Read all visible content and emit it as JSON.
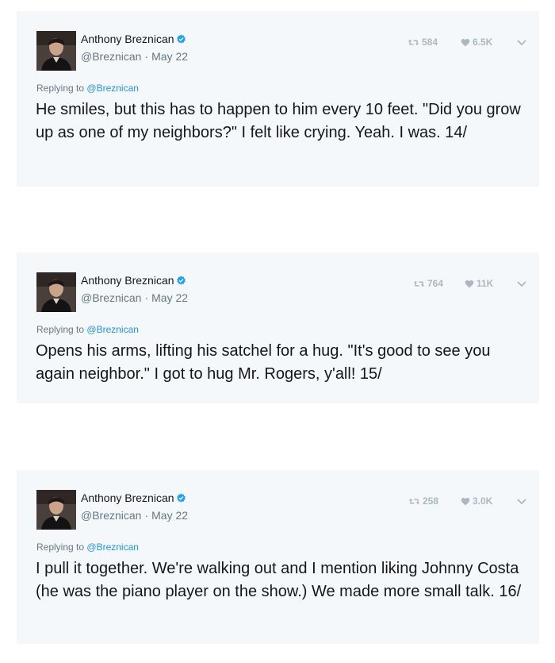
{
  "tweets": [
    {
      "author_name": "Anthony Breznican",
      "handle": "@Breznican",
      "date": "May 22",
      "retweets": "584",
      "likes": "6.5K",
      "replying_prefix": "Replying to",
      "replying_handle": "@Breznican",
      "text": "He smiles, but this has to happen to him every 10 feet. \"Did you grow up as one of my neighbors?\" I felt like crying. Yeah. I was. 14/"
    },
    {
      "author_name": "Anthony Breznican",
      "handle": "@Breznican",
      "date": "May 22",
      "retweets": "764",
      "likes": "11K",
      "replying_prefix": "Replying to",
      "replying_handle": "@Breznican",
      "text": "Opens his arms, lifting his satchel for a hug. \"It's good to see you again neighbor.\" I got to hug Mr. Rogers, y'all! 15/"
    },
    {
      "author_name": "Anthony Breznican",
      "handle": "@Breznican",
      "date": "May 22",
      "retweets": "258",
      "likes": "3.0K",
      "replying_prefix": "Replying to",
      "replying_handle": "@Breznican",
      "text": "I pull it together. We're walking out and I mention liking Johnny Costa (he was the piano player on the show.) We made more small talk. 16/"
    }
  ],
  "icons": {
    "verified": "verified-badge-icon",
    "retweet": "retweet-icon",
    "like": "heart-icon",
    "more": "chevron-down-icon"
  },
  "colors": {
    "card_background": "#f5f8fa",
    "link_blue": "#1b95e0",
    "muted_gray": "#657786",
    "icon_gray": "#aab8c2",
    "text": "#14171a"
  }
}
